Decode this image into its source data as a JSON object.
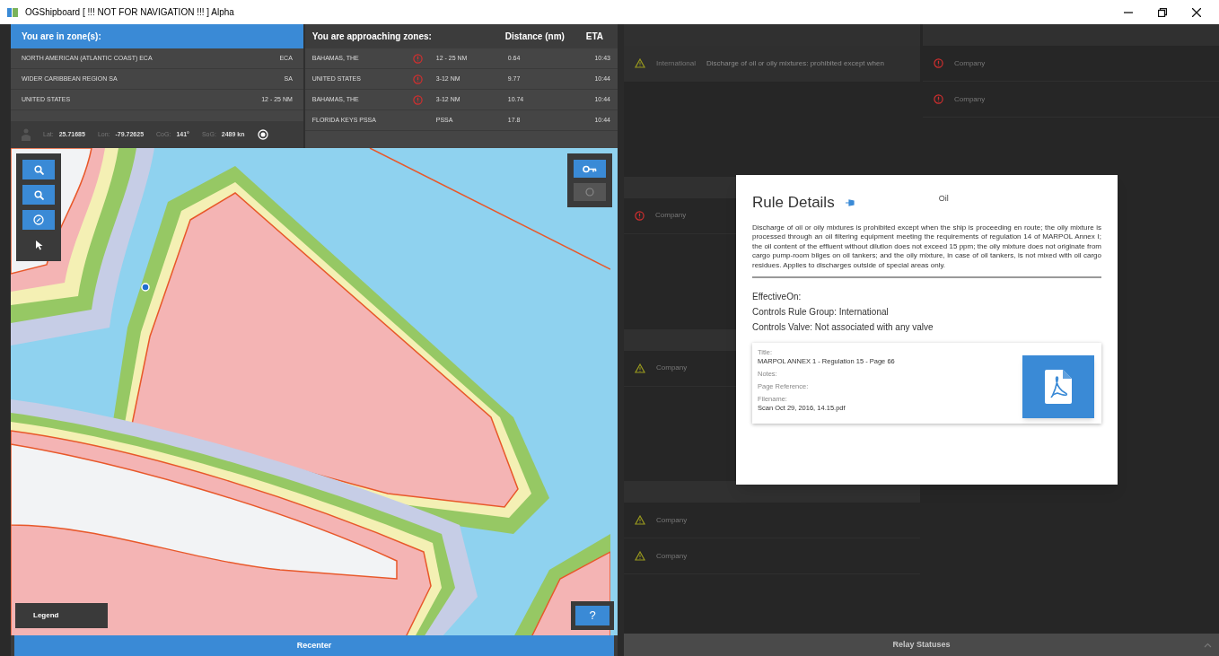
{
  "window": {
    "title": "OGShipboard [ !!! NOT FOR NAVIGATION !!! ] Alpha"
  },
  "current_zones": {
    "header": "You are in zone(s):",
    "rows": [
      {
        "name": "NORTH AMERICAN (ATLANTIC COAST) ECA",
        "type": "ECA"
      },
      {
        "name": "WIDER CARIBBEAN REGION SA",
        "type": "SA"
      },
      {
        "name": "UNITED STATES",
        "type": "12 - 25 NM"
      }
    ]
  },
  "position": {
    "lat_label": "Lat:",
    "lat": "25.71685",
    "lon_label": "Lon:",
    "lon": "-79.72625",
    "cog_label": "CoG:",
    "cog": "141°",
    "sog_label": "SoG:",
    "sog": "2489 kn"
  },
  "approaching": {
    "headers": [
      "You are approaching zones:",
      "Distance (nm)",
      "ETA"
    ],
    "rows": [
      {
        "name": "BAHAMAS, THE",
        "alert": true,
        "type": "12 - 25 NM",
        "distance": "0.64",
        "eta": "10:43"
      },
      {
        "name": "UNITED STATES",
        "alert": true,
        "type": "3-12 NM",
        "distance": "9.77",
        "eta": "10:44"
      },
      {
        "name": "BAHAMAS, THE",
        "alert": true,
        "type": "3-12 NM",
        "distance": "10.74",
        "eta": "10:44"
      },
      {
        "name": "FLORIDA KEYS PSSA",
        "alert": false,
        "type": "PSSA",
        "distance": "17.8",
        "eta": "10:44"
      }
    ]
  },
  "map": {
    "legend_label": "Legend",
    "help_label": "?",
    "recenter_label": "Recenter"
  },
  "rule_columns": [
    {
      "sections": [
        {
          "rows": [
            {
              "kind": "warning",
              "group": "International",
              "text": "Discharge of oil or oily mixtures: prohibited except when"
            }
          ]
        },
        {
          "rows": [
            {
              "kind": "alert",
              "group": "Company"
            }
          ]
        },
        {
          "rows": [
            {
              "kind": "warning",
              "group": "Company"
            }
          ]
        },
        {
          "rows": [
            {
              "kind": "warning",
              "group": "Company"
            },
            {
              "kind": "warning",
              "group": "Company"
            }
          ]
        }
      ]
    },
    {
      "sections": [
        {
          "rows": [
            {
              "kind": "alert",
              "group": "Company"
            },
            {
              "kind": "alert",
              "group": "Company"
            }
          ]
        }
      ]
    }
  ],
  "relay_bar": {
    "label": "Relay Statuses"
  },
  "rule_details": {
    "title": "Rule Details",
    "category": "Oil",
    "description": "Discharge of oil or oily mixtures is prohibited except when the ship is proceeding en route; the oily mixture is processed through an oil filtering equipment meeting the requirements of regulation 14 of MARPOL Annex I; the oil content of the effluent without dilution does not exceed 15 ppm; the oily mixture does not originate from cargo pump-room bilges on oil tankers; and the oily mixture, in case of oil tankers, is not mixed with oil cargo residues. Applies to discharges outside of special areas only.",
    "properties": [
      "EffectiveOn:",
      "Controls Rule Group: International",
      "Controls Valve: Not associated with any valve"
    ],
    "document": {
      "fields": [
        {
          "label": "Title:",
          "value": "MARPOL ANNEX 1 - Regulation 15 - Page 66"
        },
        {
          "label": "Notes:"
        },
        {
          "label": "Page Reference:"
        },
        {
          "label": "Filename:",
          "value": "Scan Oct 29, 2016, 14.15.pdf"
        }
      ]
    }
  }
}
